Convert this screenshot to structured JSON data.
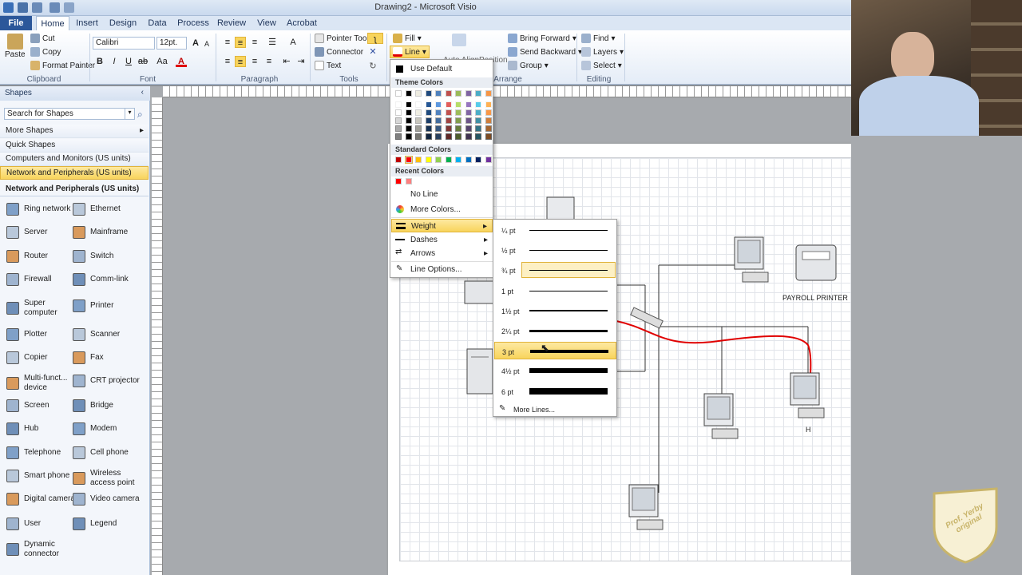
{
  "window": {
    "title": "Drawing2 - Microsoft Visio"
  },
  "tabs": [
    "File",
    "Home",
    "Insert",
    "Design",
    "Data",
    "Process",
    "Review",
    "View",
    "Acrobat"
  ],
  "ribbon": {
    "clipboard": {
      "paste": "Paste",
      "cut": "Cut",
      "copy": "Copy",
      "format_painter": "Format Painter",
      "label": "Clipboard"
    },
    "font": {
      "name": "Calibri",
      "size": "12pt.",
      "label": "Font"
    },
    "paragraph": {
      "label": "Paragraph"
    },
    "tools": {
      "pointer": "Pointer Tool",
      "connector": "Connector",
      "text": "Text",
      "label": "Tools"
    },
    "shape": {
      "fill": "Fill",
      "line": "Line",
      "auto_align": "Auto Align",
      "position": "Position"
    },
    "arrange": {
      "bring_forward": "Bring Forward",
      "send_backward": "Send Backward",
      "group": "Group",
      "label": "Arrange"
    },
    "editing": {
      "find": "Find",
      "layers": "Layers",
      "select": "Select",
      "label": "Editing"
    }
  },
  "shapes_panel": {
    "header": "Shapes",
    "search_placeholder": "Search for Shapes",
    "more_shapes": "More Shapes",
    "quick_shapes": "Quick Shapes",
    "stencils": [
      "Computers and Monitors (US units)",
      "Network and Peripherals (US units)"
    ],
    "section_title": "Network and Peripherals (US units)",
    "items": [
      [
        "Ring network",
        "Ethernet"
      ],
      [
        "Server",
        "Mainframe"
      ],
      [
        "Router",
        "Switch"
      ],
      [
        "Firewall",
        "Comm-link"
      ],
      [
        "Super computer",
        "Printer"
      ],
      [
        "Plotter",
        "Scanner"
      ],
      [
        "Copier",
        "Fax"
      ],
      [
        "Multi-funct... device",
        "CRT projector"
      ],
      [
        "Screen",
        "Bridge"
      ],
      [
        "Hub",
        "Modem"
      ],
      [
        "Telephone",
        "Cell phone"
      ],
      [
        "Smart phone",
        "Wireless access point"
      ],
      [
        "Digital camera",
        "Video camera"
      ],
      [
        "User",
        "Legend"
      ],
      [
        "Dynamic connector",
        ""
      ]
    ]
  },
  "line_menu": {
    "use_default": "Use Default",
    "theme_colors": "Theme Colors",
    "standard_colors": "Standard Colors",
    "recent_colors": "Recent Colors",
    "no_line": "No Line",
    "more_colors": "More Colors...",
    "weight": "Weight",
    "dashes": "Dashes",
    "arrows": "Arrows",
    "line_options": "Line Options...",
    "standard_swatches": [
      "#c00000",
      "#ff0000",
      "#ffc000",
      "#ffff00",
      "#92d050",
      "#00b050",
      "#00b0f0",
      "#0070c0",
      "#002060",
      "#7030a0"
    ],
    "recent_swatches": [
      "#ff0000",
      "#ff7f7f"
    ],
    "theme_top": [
      "#ffffff",
      "#000000",
      "#eeece1",
      "#1f497d",
      "#4f81bd",
      "#c0504d",
      "#9bbb59",
      "#8064a2",
      "#4bacc6",
      "#f79646"
    ]
  },
  "weight_menu": {
    "items": [
      "¼ pt",
      "½ pt",
      "¾ pt",
      "1 pt",
      "1½ pt",
      "2¼ pt",
      "3 pt",
      "4½ pt",
      "6 pt"
    ],
    "more_lines": "More Lines..."
  },
  "diagram": {
    "labels": {
      "payroll_printer": "PAYROLL PRINTER",
      "h": "H"
    }
  },
  "watermark": {
    "text": "Prof. Yerby original"
  }
}
